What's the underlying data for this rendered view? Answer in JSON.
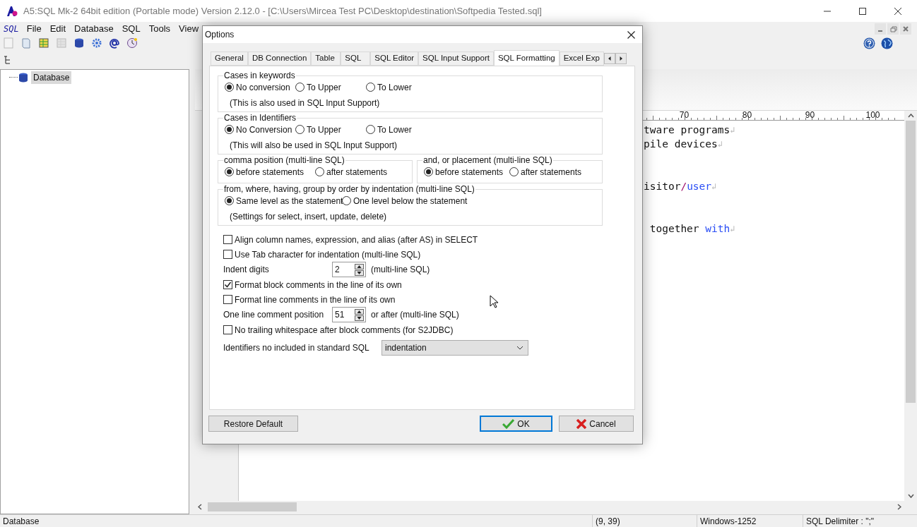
{
  "window": {
    "title": "A5:SQL Mk-2 64bit edition (Portable mode) Version 2.12.0 - [C:\\Users\\Mircea Test PC\\Desktop\\destination\\Softpedia Tested.sql]"
  },
  "menu": {
    "logo": "SQL",
    "items": [
      "File",
      "Edit",
      "Database",
      "SQL",
      "Tools",
      "View"
    ]
  },
  "toolbar": [
    {
      "disabled": false
    },
    {
      "disabled": false
    },
    {
      "disabled": false
    },
    {
      "disabled": true
    },
    {
      "disabled": false
    },
    {
      "disabled": false
    },
    {
      "disabled": false
    },
    {
      "disabled": false
    }
  ],
  "tree": [
    {
      "label": "Database",
      "selected": true
    }
  ],
  "editor": {
    "ruler": [
      "70",
      "80",
      "90",
      "100"
    ],
    "eol": "↲",
    "lines": [
      {
        "segments": [
          {
            "text": "tware programs",
            "kind": "plain"
          }
        ]
      },
      {
        "segments": [
          {
            "text": "pile devices",
            "kind": "plain"
          }
        ]
      },
      {
        "segments": [
          {
            "text": "isitor",
            "kind": "plain"
          },
          {
            "text": "/",
            "kind": "operator"
          },
          {
            "text": "user",
            "kind": "keyword"
          }
        ]
      },
      {
        "segments": [
          {
            "text": " together ",
            "kind": "plain"
          },
          {
            "text": "with",
            "kind": "keyword"
          }
        ]
      }
    ]
  },
  "dialog": {
    "title": "Options",
    "tabs": [
      {
        "label": "General",
        "selected": false
      },
      {
        "label": "DB Connection",
        "selected": false
      },
      {
        "label": "Table",
        "selected": false
      },
      {
        "label": "SQL",
        "selected": false
      },
      {
        "label": "SQL Editor",
        "selected": false
      },
      {
        "label": "SQL Input Support",
        "selected": false
      },
      {
        "label": "SQL Formatting",
        "selected": true
      },
      {
        "label": "Excel Exp",
        "selected": false
      }
    ],
    "groups": [
      {
        "title": "Cases in keywords",
        "options": [
          {
            "label": "No conversion",
            "selected": true
          },
          {
            "label": "To Upper",
            "selected": false
          },
          {
            "label": "To Lower",
            "selected": false
          }
        ],
        "note": "(This is also used in SQL Input Support)"
      },
      {
        "title": "Cases in Identifiers",
        "options": [
          {
            "label": "No Conversion",
            "selected": true
          },
          {
            "label": "To Upper",
            "selected": false
          },
          {
            "label": "To Lower",
            "selected": false
          }
        ],
        "note": "(This will also be used in SQL Input Support)"
      },
      {
        "title": "comma position (multi-line SQL)",
        "options": [
          {
            "label": "before statements",
            "selected": true
          },
          {
            "label": "after statements",
            "selected": false
          }
        ]
      },
      {
        "title": "and, or placement (multi-line SQL)",
        "options": [
          {
            "label": "before statements",
            "selected": true
          },
          {
            "label": "after statements",
            "selected": false
          }
        ]
      },
      {
        "title": "from, where, having, group by order by indentation (multi-line SQL)",
        "options": [
          {
            "label": "Same level as the statement",
            "selected": true
          },
          {
            "label": "One level below the statement",
            "selected": false
          }
        ],
        "note": "(Settings for select, insert, update, delete)"
      }
    ],
    "settings": [
      {
        "kind": "checkbox",
        "label": "Align column names, expression, and alias (after AS) in SELECT",
        "checked": false
      },
      {
        "kind": "checkbox",
        "label": "Use Tab character for indentation (multi-line SQL)",
        "checked": false
      },
      {
        "kind": "spin",
        "label": "Indent digits",
        "value": "2",
        "suffix": "(multi-line SQL)"
      },
      {
        "kind": "checkbox",
        "label": "Format block comments in the line of its own",
        "checked": true
      },
      {
        "kind": "checkbox",
        "label": "Format line comments in the line of its own",
        "checked": false
      },
      {
        "kind": "spin",
        "label": "One line comment position",
        "value": "51",
        "suffix": "or after (multi-line SQL)"
      },
      {
        "kind": "checkbox",
        "label": "No trailing whitespace after block comments (for S2JDBC)",
        "checked": false
      },
      {
        "kind": "select",
        "label": "Identifiers no included in standard SQL",
        "value": "indentation"
      }
    ],
    "buttons": [
      {
        "label": "Restore Default",
        "kind": "plain",
        "default": false
      },
      {
        "label": "OK",
        "kind": "ok",
        "default": true
      },
      {
        "label": "Cancel",
        "kind": "cancel",
        "default": false
      }
    ]
  },
  "status_bar": [
    "Database",
    "(9, 39)",
    "Windows-1252",
    "SQL Delimiter : \";\""
  ]
}
